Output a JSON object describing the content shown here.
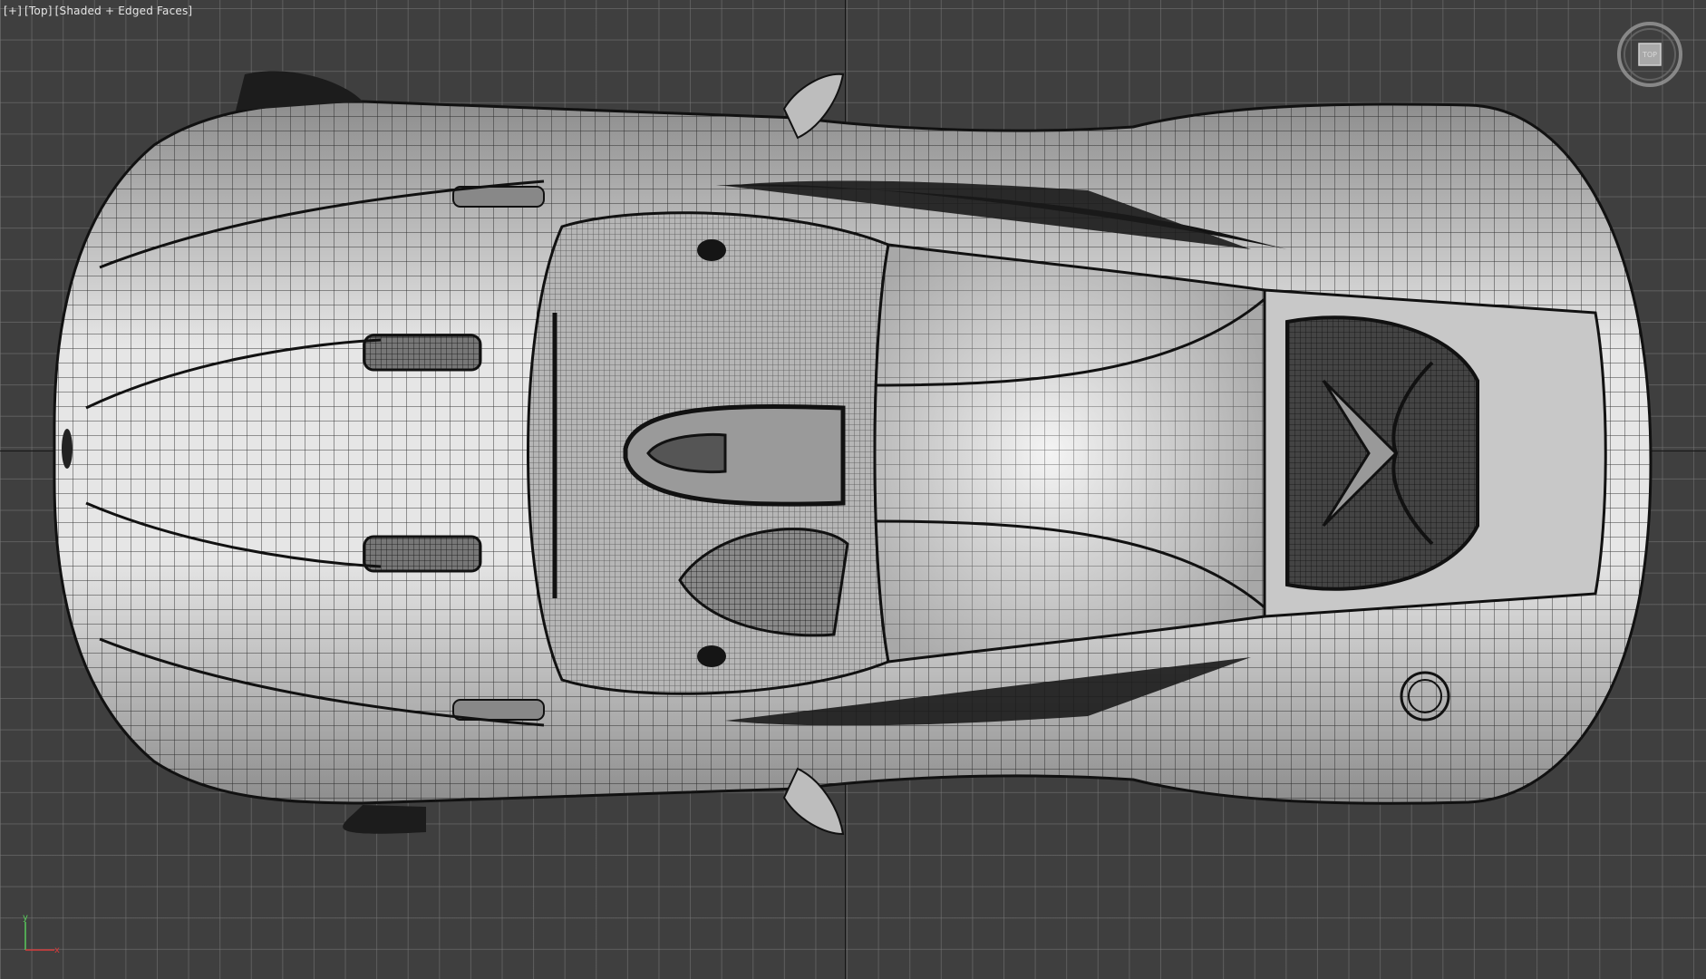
{
  "viewport": {
    "label_plus": "[+]",
    "label_view": "[Top]",
    "label_shading": "[Shaded + Edged Faces]",
    "background_color": "#3f3f3f",
    "grid_color": "#787878",
    "axis_color": "#161616"
  },
  "viewcube": {
    "face_label": "TOP",
    "icon": "viewcube-icon"
  },
  "axis_tripod": {
    "icon": "xyz-axis-icon",
    "y_color": "#59c95b",
    "x_color": "#d23b3b"
  },
  "model": {
    "icon": "sports-car-mesh",
    "shading": "#cfcfcf",
    "wire_color": "#111111"
  }
}
